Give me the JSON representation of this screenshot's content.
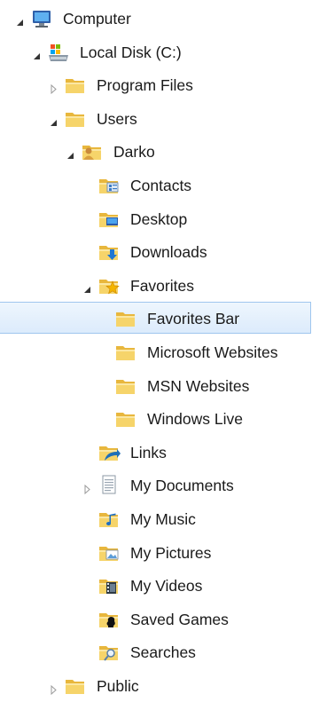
{
  "tree": {
    "nodes": [
      {
        "key": "computer",
        "label": "Computer",
        "depth": 0,
        "expander": "expanded",
        "icon": "computer-icon"
      },
      {
        "key": "local-disk-c",
        "label": "Local Disk (C:)",
        "depth": 1,
        "expander": "expanded",
        "icon": "drive-icon"
      },
      {
        "key": "program-files",
        "label": "Program Files",
        "depth": 2,
        "expander": "collapsed",
        "icon": "folder-icon"
      },
      {
        "key": "users",
        "label": "Users",
        "depth": 2,
        "expander": "expanded",
        "icon": "folder-icon"
      },
      {
        "key": "darko",
        "label": "Darko",
        "depth": 3,
        "expander": "expanded",
        "icon": "user-folder-icon"
      },
      {
        "key": "contacts",
        "label": "Contacts",
        "depth": 4,
        "expander": "none",
        "icon": "contacts-folder-icon"
      },
      {
        "key": "desktop",
        "label": "Desktop",
        "depth": 4,
        "expander": "none",
        "icon": "desktop-folder-icon"
      },
      {
        "key": "downloads",
        "label": "Downloads",
        "depth": 4,
        "expander": "none",
        "icon": "downloads-folder-icon"
      },
      {
        "key": "favorites",
        "label": "Favorites",
        "depth": 4,
        "expander": "expanded",
        "icon": "favorites-folder-icon"
      },
      {
        "key": "favorites-bar",
        "label": "Favorites Bar",
        "depth": 5,
        "expander": "none",
        "icon": "folder-icon",
        "selected": true
      },
      {
        "key": "microsoft-websites",
        "label": "Microsoft Websites",
        "depth": 5,
        "expander": "none",
        "icon": "folder-icon"
      },
      {
        "key": "msn-websites",
        "label": "MSN Websites",
        "depth": 5,
        "expander": "none",
        "icon": "folder-icon"
      },
      {
        "key": "windows-live",
        "label": "Windows Live",
        "depth": 5,
        "expander": "none",
        "icon": "folder-icon"
      },
      {
        "key": "links",
        "label": "Links",
        "depth": 4,
        "expander": "none",
        "icon": "links-folder-icon"
      },
      {
        "key": "my-documents",
        "label": "My Documents",
        "depth": 4,
        "expander": "collapsed",
        "icon": "documents-folder-icon"
      },
      {
        "key": "my-music",
        "label": "My Music",
        "depth": 4,
        "expander": "none",
        "icon": "music-folder-icon"
      },
      {
        "key": "my-pictures",
        "label": "My Pictures",
        "depth": 4,
        "expander": "none",
        "icon": "pictures-folder-icon"
      },
      {
        "key": "my-videos",
        "label": "My Videos",
        "depth": 4,
        "expander": "none",
        "icon": "videos-folder-icon"
      },
      {
        "key": "saved-games",
        "label": "Saved Games",
        "depth": 4,
        "expander": "none",
        "icon": "saved-games-folder-icon"
      },
      {
        "key": "searches",
        "label": "Searches",
        "depth": 4,
        "expander": "none",
        "icon": "searches-folder-icon"
      },
      {
        "key": "public",
        "label": "Public",
        "depth": 2,
        "expander": "collapsed",
        "icon": "folder-icon"
      }
    ]
  },
  "colors": {
    "selection_fill": "#dcebfc",
    "selection_border": "#9fc6ee",
    "folder": "#f2c94c"
  }
}
